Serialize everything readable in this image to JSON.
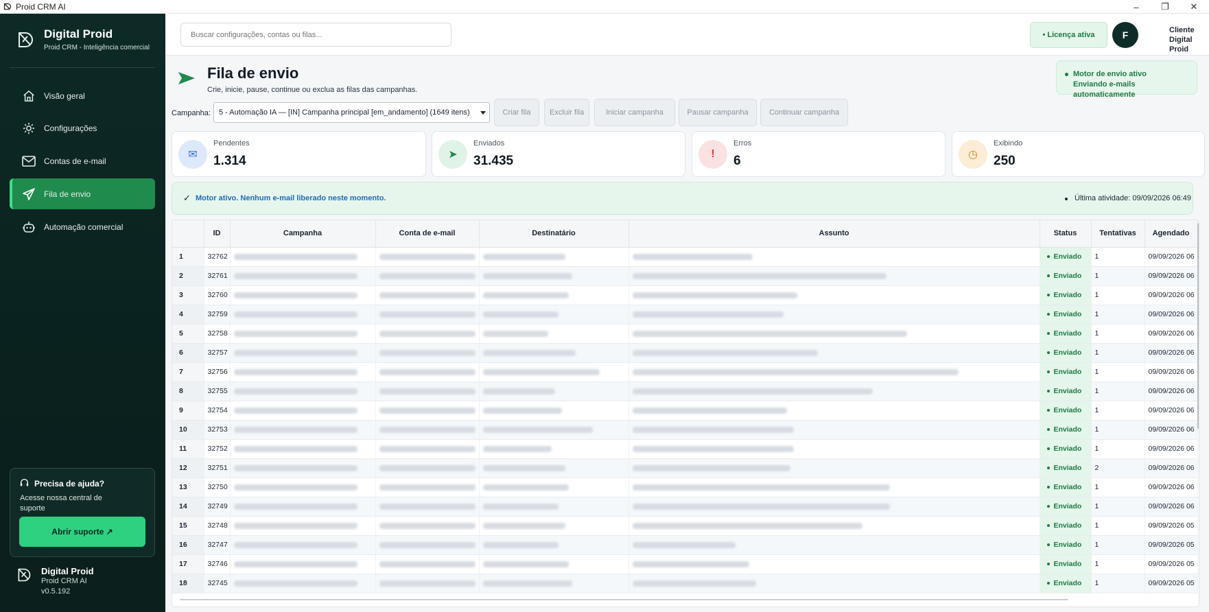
{
  "window": {
    "title": "Proid CRM AI",
    "minimize": "–",
    "maximize": "❐",
    "close": "✕"
  },
  "sidebar": {
    "brand_name": "Digital Proid",
    "brand_sub": "Proid CRM - Inteligência comercial",
    "items": [
      {
        "label": "Visão geral",
        "icon": "home-icon"
      },
      {
        "label": "Configurações",
        "icon": "gear-icon"
      },
      {
        "label": "Contas de e-mail",
        "icon": "mail-icon"
      },
      {
        "label": "Fila de envio",
        "icon": "send-icon",
        "active": true
      },
      {
        "label": "Automação comercial",
        "icon": "robot-icon"
      }
    ],
    "help": {
      "title": "Precisa de ajuda?",
      "text": "Acesse nossa central de suporte",
      "button": "Abrir suporte ↗"
    },
    "footer": {
      "name": "Digital Proid",
      "app": "Proid CRM AI",
      "version": "v0.5.192"
    }
  },
  "topbar": {
    "search_placeholder": "Buscar configurações, contas ou filas...",
    "license": "• Licença ativa",
    "avatar_letter": "F",
    "client_line1": "Cliente",
    "client_line2": "Digital Proid"
  },
  "page": {
    "title": "Fila de envio",
    "subtitle": "Crie, inicie, pause, continue ou exclua as filas das campanhas.",
    "engine_line1": "Motor de envio ativo",
    "engine_line2": "Enviando e-mails automaticamente"
  },
  "controls": {
    "campaign_label": "Campanha:",
    "campaign_value": "5 - Automação IA — [IN] Campanha principal [em_andamento] (1649 itens)",
    "buttons": [
      "Criar fila",
      "Excluir fila",
      "Iniciar campanha",
      "Pausar campanha",
      "Continuar campanha"
    ]
  },
  "stats": [
    {
      "label": "Pendentes",
      "value": "1.314",
      "icon": "envelope-icon",
      "color": "#dde8fb",
      "icon_color": "#3b6fd4",
      "glyph": "✉"
    },
    {
      "label": "Enviados",
      "value": "31.435",
      "icon": "send-icon",
      "color": "#dff3e6",
      "icon_color": "#1d8a4a",
      "glyph": "➤"
    },
    {
      "label": "Erros",
      "value": "6",
      "icon": "alert-icon",
      "color": "#fbe1e1",
      "icon_color": "#d93b3b",
      "glyph": "!"
    },
    {
      "label": "Exibindo",
      "value": "250",
      "icon": "clock-icon",
      "color": "#fdecd6",
      "icon_color": "#d9861c",
      "glyph": "◷"
    }
  ],
  "status": {
    "message": "Motor ativo. Nenhum e-mail liberado neste momento.",
    "last_activity": "Última atividade: 09/09/2026 06:49"
  },
  "table": {
    "headers": [
      "",
      "ID",
      "Campanha",
      "Conta de e-mail",
      "Destinatário",
      "Assunto",
      "Status",
      "Tentativas",
      "Agendado"
    ],
    "rows": [
      {
        "n": "1",
        "id": "32762",
        "status": "Enviado",
        "tries": "1",
        "sched": "09/09/2026 06"
      },
      {
        "n": "2",
        "id": "32761",
        "status": "Enviado",
        "tries": "1",
        "sched": "09/09/2026 06"
      },
      {
        "n": "3",
        "id": "32760",
        "status": "Enviado",
        "tries": "1",
        "sched": "09/09/2026 06"
      },
      {
        "n": "4",
        "id": "32759",
        "status": "Enviado",
        "tries": "1",
        "sched": "09/09/2026 06"
      },
      {
        "n": "5",
        "id": "32758",
        "status": "Enviado",
        "tries": "1",
        "sched": "09/09/2026 06"
      },
      {
        "n": "6",
        "id": "32757",
        "status": "Enviado",
        "tries": "1",
        "sched": "09/09/2026 06"
      },
      {
        "n": "7",
        "id": "32756",
        "status": "Enviado",
        "tries": "1",
        "sched": "09/09/2026 06"
      },
      {
        "n": "8",
        "id": "32755",
        "status": "Enviado",
        "tries": "1",
        "sched": "09/09/2026 06"
      },
      {
        "n": "9",
        "id": "32754",
        "status": "Enviado",
        "tries": "1",
        "sched": "09/09/2026 06"
      },
      {
        "n": "10",
        "id": "32753",
        "status": "Enviado",
        "tries": "1",
        "sched": "09/09/2026 06"
      },
      {
        "n": "11",
        "id": "32752",
        "status": "Enviado",
        "tries": "1",
        "sched": "09/09/2026 06"
      },
      {
        "n": "12",
        "id": "32751",
        "status": "Enviado",
        "tries": "2",
        "sched": "09/09/2026 06"
      },
      {
        "n": "13",
        "id": "32750",
        "status": "Enviado",
        "tries": "1",
        "sched": "09/09/2026 06"
      },
      {
        "n": "14",
        "id": "32749",
        "status": "Enviado",
        "tries": "1",
        "sched": "09/09/2026 06"
      },
      {
        "n": "15",
        "id": "32748",
        "status": "Enviado",
        "tries": "1",
        "sched": "09/09/2026 05"
      },
      {
        "n": "16",
        "id": "32747",
        "status": "Enviado",
        "tries": "1",
        "sched": "09/09/2026 05"
      },
      {
        "n": "17",
        "id": "32746",
        "status": "Enviado",
        "tries": "1",
        "sched": "09/09/2026 05"
      },
      {
        "n": "18",
        "id": "32745",
        "status": "Enviado",
        "tries": "1",
        "sched": "09/09/2026 05"
      }
    ]
  }
}
